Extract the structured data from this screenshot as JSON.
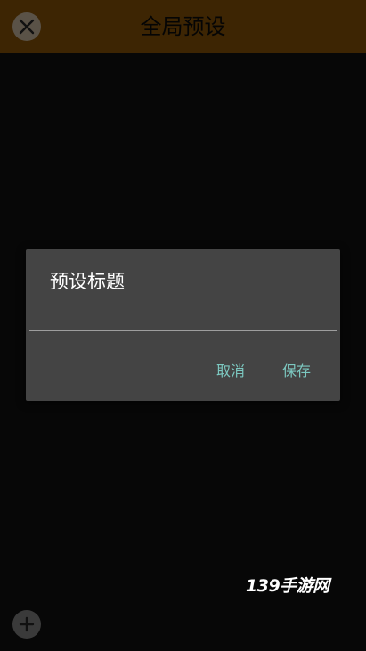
{
  "header": {
    "title": "全局预设",
    "close_icon": "close-icon"
  },
  "dialog": {
    "title": "预设标题",
    "input_value": "",
    "cancel_label": "取消",
    "save_label": "保存"
  },
  "footer": {
    "add_icon": "plus-icon"
  },
  "watermark": {
    "text": "139手游网"
  },
  "colors": {
    "topbar": "#3d2503",
    "background": "#070707",
    "dialog": "#444444",
    "accent": "#7cc8c0"
  }
}
